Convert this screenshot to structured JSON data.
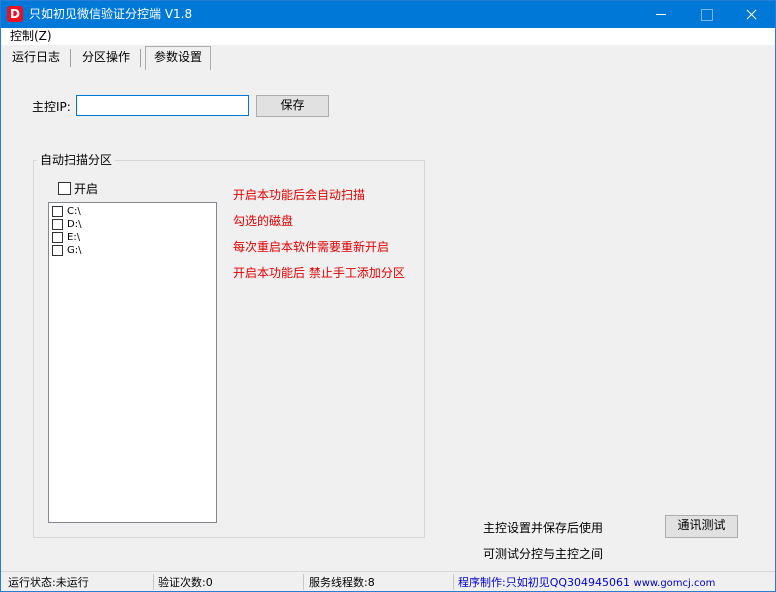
{
  "window": {
    "logo_letter": "D",
    "title": "只如初见微信验证分控端 V1.8"
  },
  "menu": {
    "items": [
      {
        "label": "控制(Z)"
      }
    ]
  },
  "tabs": [
    {
      "label": "运行日志"
    },
    {
      "label": "分区操作"
    },
    {
      "label": "参数设置",
      "active": true
    }
  ],
  "host": {
    "label": "主控IP:",
    "value": "",
    "save_label": "保存"
  },
  "auto_scan": {
    "group_title": "自动扫描分区",
    "enable_label": "开启",
    "enabled": false,
    "drives": [
      {
        "label": "C:\\",
        "checked": false
      },
      {
        "label": "D:\\",
        "checked": false
      },
      {
        "label": "E:\\",
        "checked": false
      },
      {
        "label": "G:\\",
        "checked": false
      }
    ],
    "notes": [
      "开启本功能后会自动扫描",
      "勾选的磁盘",
      "每次重启本软件需要重新开启",
      "开启本功能后 禁止手工添加分区"
    ]
  },
  "comm": {
    "hint_line1": "主控设置并保存后使用",
    "hint_line2": "可测试分控与主控之间",
    "test_label": "通讯测试"
  },
  "status": {
    "run_state": "运行状态:未运行",
    "verify_count": "验证次数:0",
    "service_threads": "服务线程数:8",
    "credit": "程序制作:只如初见QQ304945061",
    "credit_url": "www.gomcj.com"
  },
  "colors": {
    "titlebar": "#0078d7",
    "note_red": "#e00000",
    "credit_blue": "#0000cc"
  }
}
